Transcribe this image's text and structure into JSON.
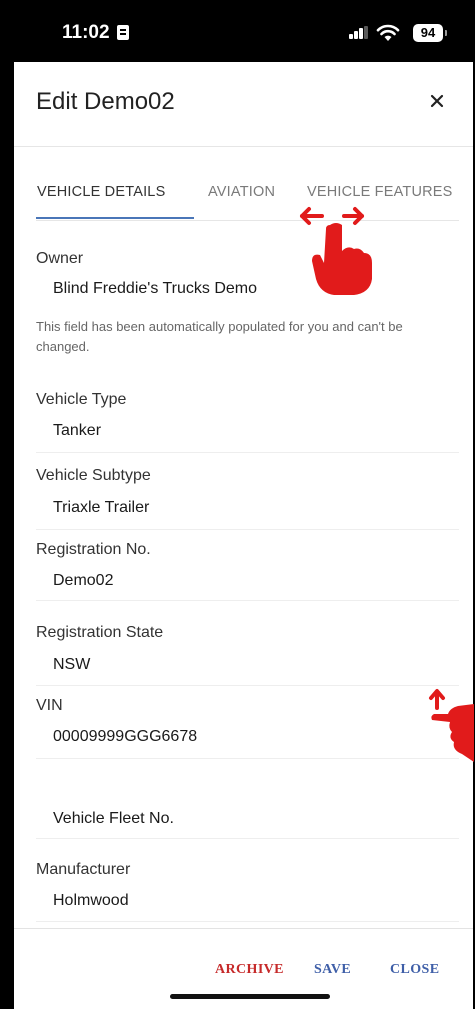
{
  "status_bar": {
    "time": "11:02",
    "battery": "94"
  },
  "header": {
    "title": "Edit Demo02",
    "close_icon": "close-icon"
  },
  "tabs": [
    {
      "label": "VEHICLE DETAILS",
      "active": true
    },
    {
      "label": "AVIATION",
      "active": false
    },
    {
      "label": "VEHICLE FEATURES",
      "active": false
    }
  ],
  "fields": {
    "owner": {
      "label": "Owner",
      "value": "Blind Freddie's Trucks Demo"
    },
    "owner_helper": "This field has been automatically populated for you and can't be changed.",
    "vehicle_type": {
      "label": "Vehicle Type",
      "value": "Tanker"
    },
    "vehicle_subtype": {
      "label": "Vehicle Subtype",
      "value": "Triaxle Trailer"
    },
    "registration_no": {
      "label": "Registration No.",
      "value": "Demo02"
    },
    "registration_state": {
      "label": "Registration State",
      "value": "NSW"
    },
    "vin": {
      "label": "VIN",
      "value": "00009999GGG6678"
    },
    "vehicle_fleet_no": {
      "placeholder": "Vehicle Fleet No."
    },
    "manufacturer": {
      "label": "Manufacturer",
      "value": "Holmwood"
    }
  },
  "footer": {
    "archive": "ARCHIVE",
    "save": "SAVE",
    "close": "CLOSE"
  },
  "colors": {
    "accent_blue": "#3f5fa8",
    "archive_red": "#c62a2a",
    "tab_indicator": "#4a76b8",
    "gesture_red": "#e11b1b"
  },
  "icons": [
    "sim-card-icon",
    "cellular-signal-icon",
    "wifi-icon",
    "battery-icon",
    "close-icon",
    "swipe-horizontal-hand-icon",
    "swipe-up-hand-icon"
  ]
}
